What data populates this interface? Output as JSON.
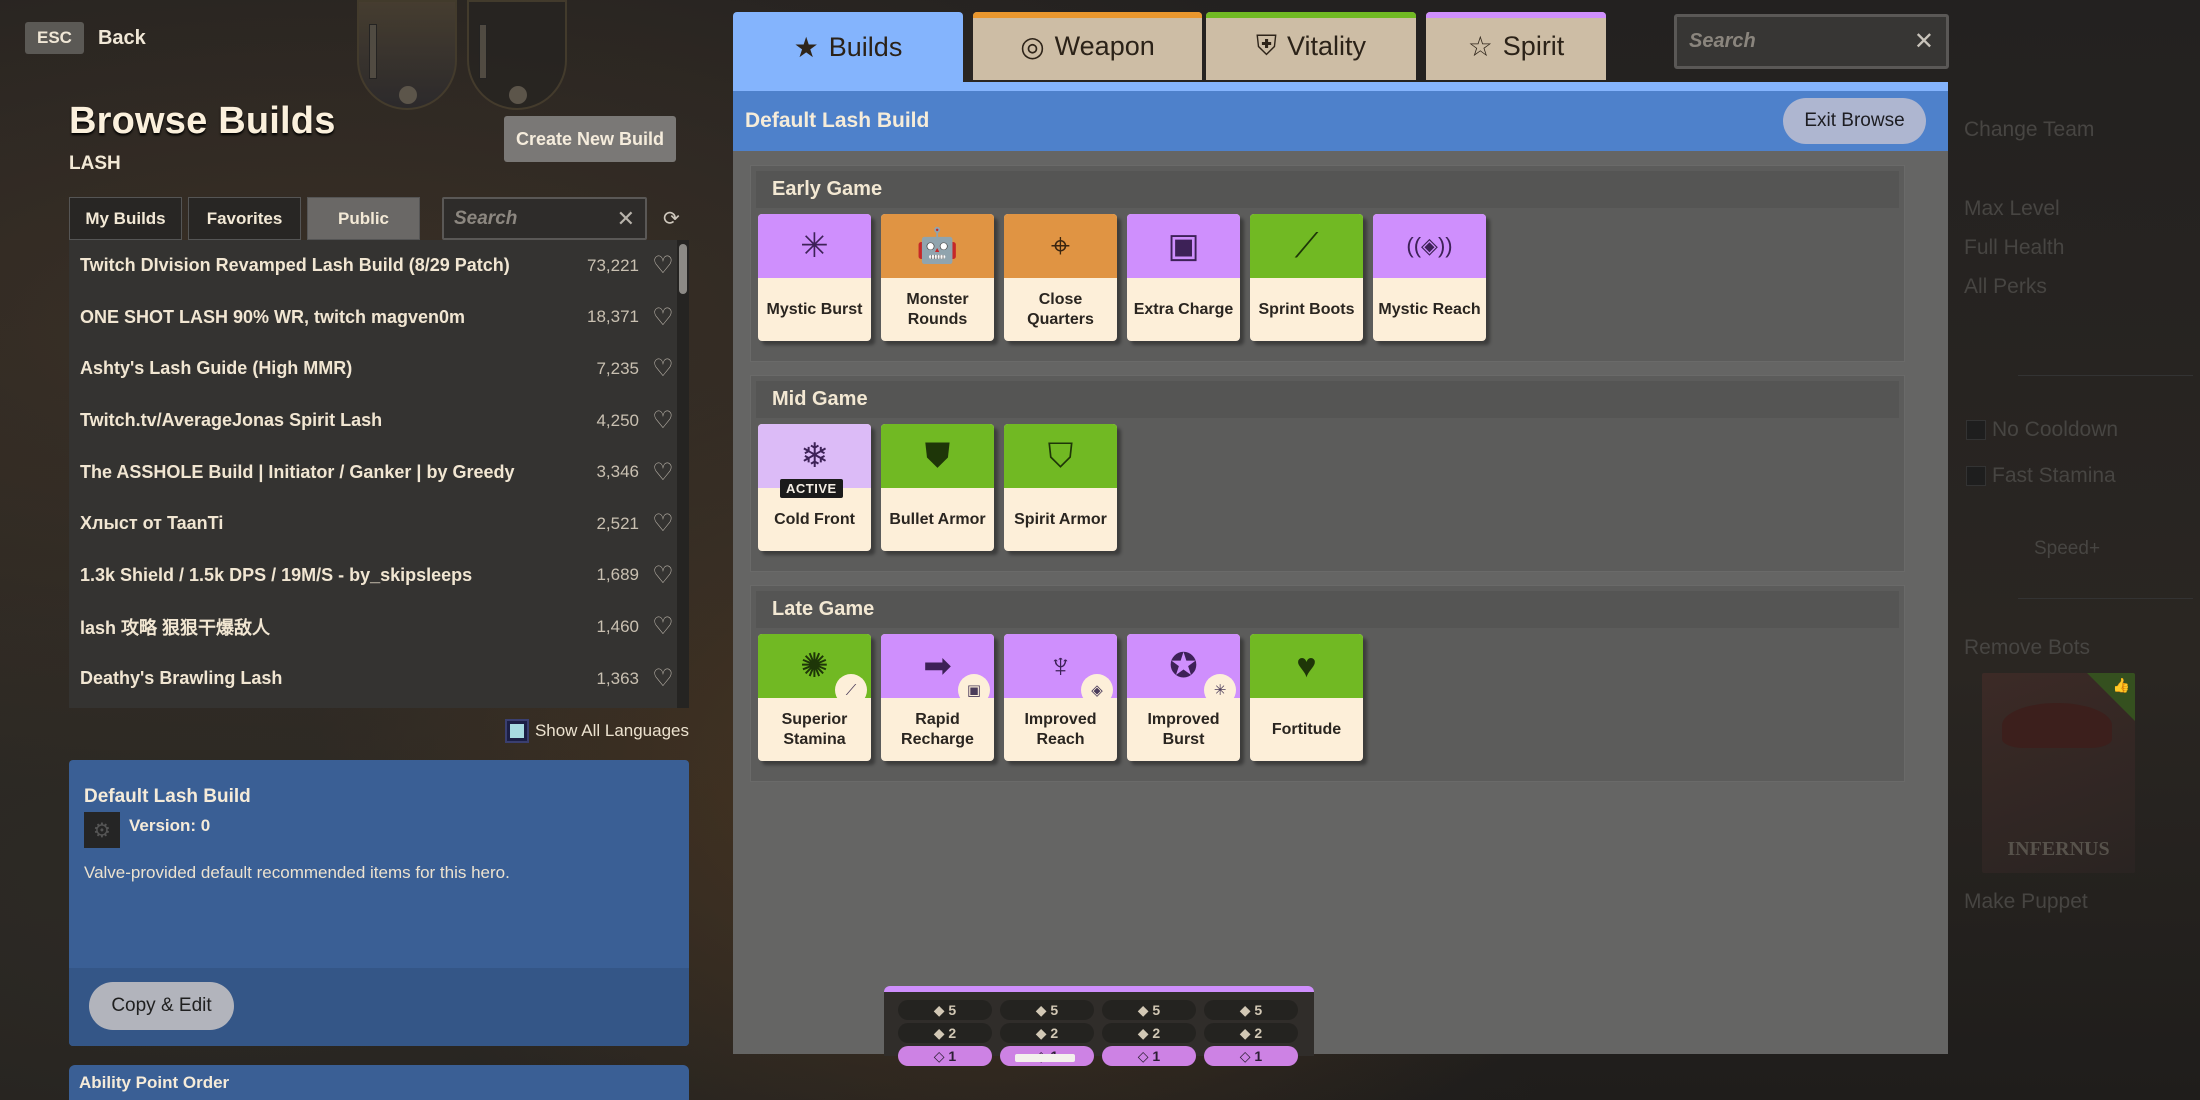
{
  "nav": {
    "esc_key": "ESC",
    "back_label": "Back"
  },
  "left": {
    "title": "Browse Builds",
    "hero": "LASH",
    "create_button": "Create New Build",
    "tabs": [
      {
        "label": "My Builds",
        "active": false
      },
      {
        "label": "Favorites",
        "active": false
      },
      {
        "label": "Public",
        "active": true
      }
    ],
    "search": {
      "placeholder": "Search",
      "value": ""
    },
    "builds": [
      {
        "name": "Twitch DIvision Revamped Lash Build (8/29 Patch)",
        "favorites": "73,221"
      },
      {
        "name": "ONE SHOT LASH 90% WR, twitch magven0m",
        "favorites": "18,371"
      },
      {
        "name": "Ashty's Lash Guide (High MMR)",
        "favorites": "7,235"
      },
      {
        "name": "Twitch.tv/AverageJonas Spirit Lash",
        "favorites": "4,250"
      },
      {
        "name": "The ASSHOLE Build | Initiator / Ganker | by Greedy",
        "favorites": "3,346"
      },
      {
        "name": "Хлыст от TaanTi",
        "favorites": "2,521"
      },
      {
        "name": "1.3k Shield / 1.5k DPS / 19M/S - by_skipsleeps",
        "favorites": "1,689"
      },
      {
        "name": "lash 攻略 狠狠干爆敌人",
        "favorites": "1,460"
      },
      {
        "name": "Deathy's Brawling Lash",
        "favorites": "1,363"
      }
    ],
    "show_all_languages": {
      "label": "Show All Languages",
      "checked": false
    },
    "selected_build": {
      "title": "Default Lash Build",
      "version": "Version: 0",
      "description": "Valve-provided default recommended items for this hero.",
      "copy_button": "Copy & Edit"
    },
    "ability_point_order_title": "Ability Point Order"
  },
  "modal": {
    "tabs": [
      {
        "label": "Builds",
        "icon": "star-icon",
        "active": true
      },
      {
        "label": "Weapon",
        "icon": "weapon-icon",
        "accent": "#e9972e"
      },
      {
        "label": "Vitality",
        "icon": "vitality-shield-icon",
        "accent": "#71b923"
      },
      {
        "label": "Spirit",
        "icon": "spirit-star-icon",
        "accent": "#cf8ffd"
      }
    ],
    "search": {
      "placeholder": "Search",
      "value": ""
    },
    "build_title": "Default Lash Build",
    "exit_button": "Exit Browse",
    "sections": [
      {
        "title": "Early Game",
        "items": [
          {
            "name": "Mystic Burst",
            "category": "spirit",
            "glyph": "✳"
          },
          {
            "name": "Monster Rounds",
            "category": "weapon",
            "glyph": "🤖"
          },
          {
            "name": "Close Quarters",
            "category": "weapon",
            "glyph": "⌖"
          },
          {
            "name": "Extra Charge",
            "category": "spirit",
            "glyph": "▣"
          },
          {
            "name": "Sprint Boots",
            "category": "vitality",
            "glyph": "⟋"
          },
          {
            "name": "Mystic Reach",
            "category": "spirit",
            "glyph": "((◈))"
          }
        ]
      },
      {
        "title": "Mid Game",
        "items": [
          {
            "name": "Cold Front",
            "category": "spirit-active",
            "glyph": "❄",
            "tag": "ACTIVE"
          },
          {
            "name": "Bullet Armor",
            "category": "vitality",
            "glyph": "⛊"
          },
          {
            "name": "Spirit Armor",
            "category": "vitality",
            "glyph": "⛉"
          }
        ]
      },
      {
        "title": "Late Game",
        "items": [
          {
            "name": "Superior Stamina",
            "category": "vitality",
            "glyph": "✺",
            "upgrade_from": "⟋"
          },
          {
            "name": "Rapid Recharge",
            "category": "spirit",
            "glyph": "➡",
            "upgrade_from": "▣"
          },
          {
            "name": "Improved Reach",
            "category": "spirit",
            "glyph": "♆",
            "upgrade_from": "◈"
          },
          {
            "name": "Improved Burst",
            "category": "spirit",
            "glyph": "✪",
            "upgrade_from": "✳"
          },
          {
            "name": "Fortitude",
            "category": "vitality",
            "glyph": "♥"
          }
        ]
      }
    ],
    "ability_points": {
      "columns": [
        {
          "rows": [
            "◆ 5",
            "◆ 2",
            "◇ 1"
          ]
        },
        {
          "rows": [
            "◆ 5",
            "◆ 2",
            "◇ 1"
          ]
        },
        {
          "rows": [
            "◆ 5",
            "◆ 2",
            "◇ 1"
          ]
        },
        {
          "rows": [
            "◆ 5",
            "◆ 2",
            "◇ 1"
          ]
        }
      ],
      "selected_row": 2
    }
  },
  "sandbox_menu": {
    "change_team": "Change Team",
    "max_level": "Max Level",
    "full_health": "Full Health",
    "all_perks": "All Perks",
    "no_cooldown": "No Cooldown",
    "fast_stamina": "Fast Stamina",
    "speed": "Speed+",
    "remove_bots": "Remove Bots",
    "hero_card_name": "INFERNUS",
    "make_puppet": "Make Puppet"
  }
}
